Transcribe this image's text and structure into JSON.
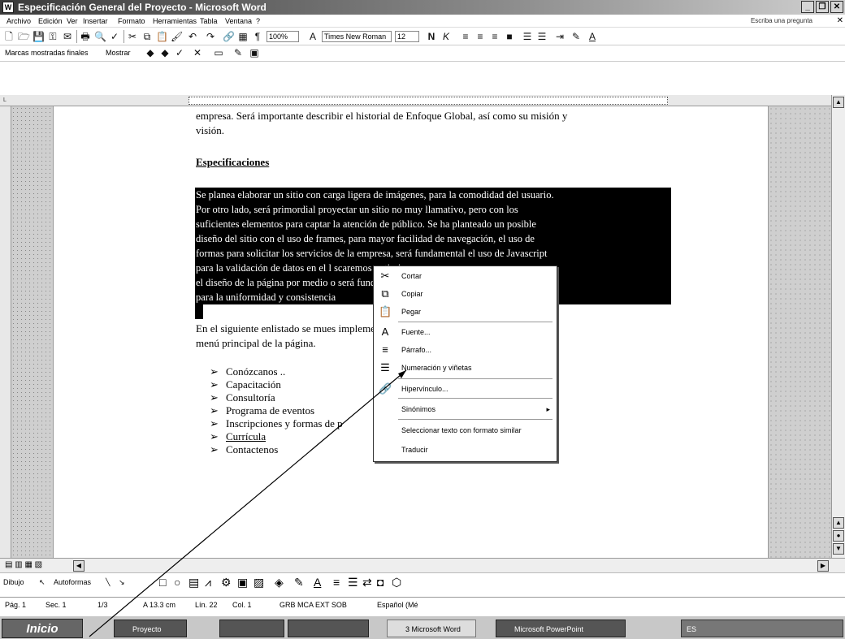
{
  "window": {
    "title": "Especificación General del Proyecto - Microsoft Word"
  },
  "menubar": {
    "items": [
      "Archivo",
      "Edición",
      "Ver",
      "Insertar",
      "Formato",
      "Herramientas",
      "Tabla",
      "Ventana",
      "?"
    ],
    "help_placeholder": "Escriba una pregunta"
  },
  "toolbar": {
    "zoom": "100%",
    "font": "Times New Roman",
    "size": "12"
  },
  "review_toolbar": {
    "markup_view": "Marcas mostradas finales",
    "show_label": "Mostrar"
  },
  "document": {
    "para_top_line1": "empresa. Será importante describir el historial de Enfoque Global, así como su misión y",
    "para_top_line2": "visión.",
    "heading": "Especificaciones",
    "highlight_lines": [
      "Se planea elaborar un sitio con carga ligera de imágenes, para la comodidad del usuario.",
      "Por otro lado, será primordial proyectar un sitio no muy llamativo, pero con los",
      "suficientes elementos para captar la atención de público. Se ha planteado un posible",
      "diseño del sitio con el uso de frames, para mayor facilidad de navegación, el uso de",
      "formas para solicitar los servicios de la empresa, será fundamental el uso de Javascript",
      "para la validación de datos en el l                                          scaremos optimizar",
      "el diseño de la página por medio                                                o será fundamental",
      "para la uniformidad y consistencia"
    ],
    "list_intro_line1": "En el siguiente enlistado se mues                                             implementar en el",
    "list_intro_line2": "menú principal de la página.",
    "bullets": [
      "Conózcanos ..",
      "Capacitación",
      "Consultoría",
      "Programa de eventos",
      "Inscripciones y formas de p",
      "Currícula",
      "Contactenos"
    ]
  },
  "context_menu": {
    "items": [
      {
        "icon": "scissors-icon",
        "glyph": "✂",
        "label": "Cortar"
      },
      {
        "icon": "copy-icon",
        "glyph": "⧉",
        "label": "Copiar"
      },
      {
        "icon": "paste-icon",
        "glyph": "📋",
        "label": "Pegar"
      },
      {
        "icon": "font-icon",
        "glyph": "A",
        "label": "Fuente..."
      },
      {
        "icon": "paragraph-icon",
        "glyph": "≡",
        "label": "Párrafo..."
      },
      {
        "icon": "numbering-icon",
        "glyph": "☰",
        "label": "Numeración y viñetas"
      },
      {
        "icon": "hyperlink-icon",
        "glyph": "🔗",
        "label": "Hipervínculo..."
      },
      {
        "icon": "",
        "glyph": "",
        "label": "Sinónimos",
        "submenu": "▸"
      },
      {
        "icon": "",
        "glyph": "",
        "label": "Seleccionar texto con formato similar"
      },
      {
        "icon": "",
        "glyph": "",
        "label": "Traducir"
      }
    ]
  },
  "drawing_toolbar": {
    "draw_label": "Dibujo",
    "autoshapes_label": "Autoformas"
  },
  "statusbar": {
    "page": "Pág. 1",
    "section": "Sec. 1",
    "pages": "1/3",
    "at": "A 13.3 cm",
    "line": "Lín. 22",
    "col": "Col. 1",
    "modes": "GRB  MCA  EXT  SOB",
    "language": "Español (Mé"
  },
  "taskbar": {
    "start": "Inicio",
    "tasks": [
      "Proyecto",
      "",
      "",
      "3 Microsoft Word",
      "Microsoft PowerPoint"
    ],
    "tray_lang": "ES"
  }
}
